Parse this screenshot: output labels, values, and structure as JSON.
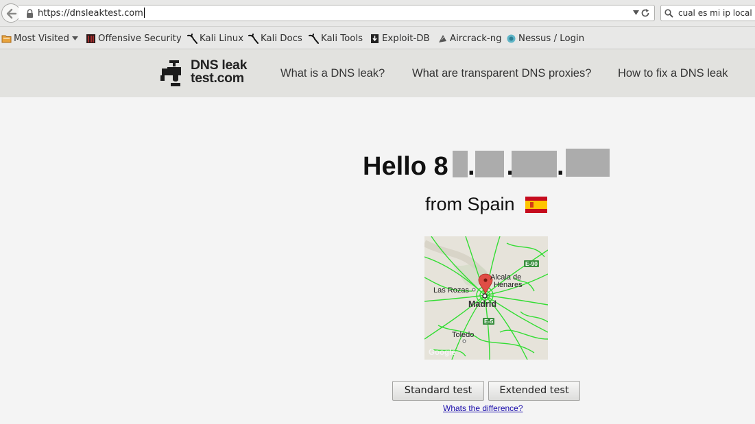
{
  "browser": {
    "url": "https://dnsleaktest.com",
    "search_value": "cual es mi ip local",
    "bookmarks": [
      {
        "label": "Most Visited",
        "icon": "folder-icon"
      },
      {
        "label": "Offensive Security",
        "icon": "offsec-icon"
      },
      {
        "label": "Kali Linux",
        "icon": "kali-dragon-icon"
      },
      {
        "label": "Kali Docs",
        "icon": "kali-dragon-icon"
      },
      {
        "label": "Kali Tools",
        "icon": "kali-dragon-icon"
      },
      {
        "label": "Exploit-DB",
        "icon": "exploitdb-icon"
      },
      {
        "label": "Aircrack-ng",
        "icon": "aircrack-icon"
      },
      {
        "label": "Nessus / Login",
        "icon": "nessus-icon"
      }
    ]
  },
  "site": {
    "logo_line1": "DNS leak",
    "logo_line2": "test.com",
    "nav": [
      "What is a DNS leak?",
      "What are transparent DNS proxies?",
      "How to fix a DNS leak"
    ]
  },
  "content": {
    "hello_prefix": "Hello 8",
    "hello_dots": [
      ".",
      " .",
      "."
    ],
    "from_text": "from Spain",
    "country_flag": "spain-flag",
    "map": {
      "labels": {
        "las_rozas": "Las Rozas",
        "alcala1": "Alcala de",
        "alcala2": "Henares",
        "madrid": "Madrid",
        "toledo": "Toledo",
        "google": "Google"
      },
      "badges": {
        "e90": "E-90",
        "e5": "E-5"
      }
    },
    "buttons": {
      "standard": "Standard test",
      "extended": "Extended test"
    },
    "difference_link": "Whats the difference?"
  },
  "colors": {
    "redaction": "#acacac",
    "header_bg": "#e2e2df",
    "link": "#1a0dab"
  }
}
